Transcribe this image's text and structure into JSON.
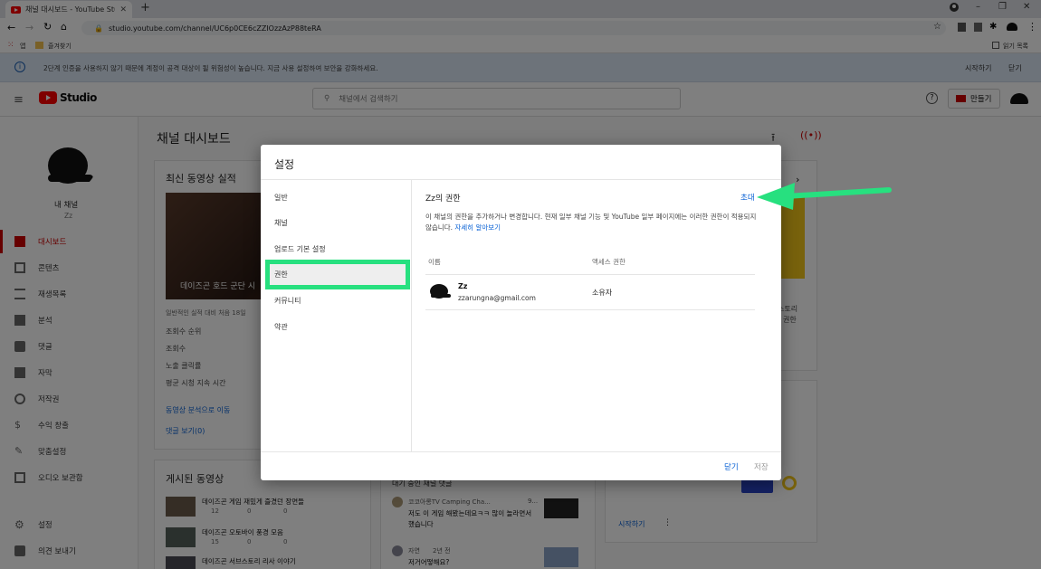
{
  "browser": {
    "tab_title": "채널 대시보드 - YouTube Studio",
    "url": "studio.youtube.com/channel/UC6p0CE6cZZIOzzAzP88teRA",
    "bookmarks": {
      "apps": "앱",
      "favorites": "즐겨찾기",
      "reading_list": "읽기 목록"
    }
  },
  "banner": {
    "message": "2단계 인증을 사용하지 않기 때문에 계정이 공격 대상이 될 위험성이 높습니다. 지금 사용 설정하여 보안을 강화하세요.",
    "start": "시작하기",
    "close": "닫기"
  },
  "header": {
    "logo": "Studio",
    "search_placeholder": "채널에서 검색하기",
    "create": "만들기"
  },
  "sidebar": {
    "channel_label": "내 채널",
    "channel_name": "Zz",
    "items": [
      {
        "label": "대시보드",
        "icon": "dashboard-icon"
      },
      {
        "label": "콘텐츠",
        "icon": "content-icon"
      },
      {
        "label": "재생목록",
        "icon": "playlist-icon"
      },
      {
        "label": "분석",
        "icon": "analytics-icon"
      },
      {
        "label": "댓글",
        "icon": "comments-icon"
      },
      {
        "label": "자막",
        "icon": "subtitles-icon"
      },
      {
        "label": "저작권",
        "icon": "copyright-icon"
      },
      {
        "label": "수익 창출",
        "icon": "dollar-icon"
      },
      {
        "label": "맞춤설정",
        "icon": "customize-icon"
      },
      {
        "label": "오디오 보관함",
        "icon": "audio-library-icon"
      }
    ],
    "settings": "설정",
    "feedback": "의견 보내기"
  },
  "main": {
    "title": "채널 대시보드",
    "latest_card": {
      "title": "최신 동영상 실적",
      "video_title": "데이즈곤 호드 군단 시",
      "subtitle": "일반적인 실적 대비 처음 18일",
      "stats": [
        "조회수 순위",
        "조회수",
        "노출 클릭률",
        "평균 시청 지속 시간"
      ],
      "analytics_link": "동영상 분석으로 이동",
      "comments_link": "댓글 보기(0)"
    },
    "published": {
      "title": "게시된 동영상",
      "videos": [
        {
          "title": "데이즈곤 게임 재밌게 즐겼던 장면들",
          "views": "12",
          "comments": "0",
          "likes": "0"
        },
        {
          "title": "데이즈곤 오토바이 풍경 모음",
          "views": "15",
          "comments": "0",
          "likes": "0"
        },
        {
          "title": "데이즈곤 서브스토리 리사 이야기",
          "views": "",
          "comments": "",
          "likes": ""
        }
      ]
    },
    "comments_card": {
      "title": "대기 중인 채널 댓글",
      "items": [
        {
          "author": "코코아롱TV Camping Cha...",
          "meta": "9...",
          "text": "저도 이 게임 해봤는데요ㅋㅋ 많이 놀라면서 했습니다"
        },
        {
          "author": "자연",
          "meta": "2년 전",
          "text": "저거어떻해요?"
        }
      ]
    },
    "right_card": {
      "story_text": "스토리",
      "text2": "권한",
      "start": "시작하기"
    }
  },
  "dialog": {
    "title": "설정",
    "nav": [
      "일반",
      "채널",
      "업로드 기본 설정",
      "권한",
      "커뮤니티",
      "약관"
    ],
    "selected": "권한",
    "section_title": "Zz의 권한",
    "invite": "초대",
    "description": "이 채널의 권한을 추가하거나 변경합니다. 현재 일부 채널 기능 및 YouTube 일부 페이지에는 이러한 권한이 적용되지 않습니다.",
    "learn_more": "자세히 알아보기",
    "col_name": "이름",
    "col_access": "액세스 권한",
    "user": {
      "name": "Zz",
      "email": "zzarungna@gmail.com",
      "role": "소유자"
    },
    "close": "닫기",
    "save": "저장"
  },
  "colors": {
    "highlight": "#27e07f",
    "arrow": "#27e07f",
    "link": "#065fd4",
    "brand": "#ff0000"
  }
}
